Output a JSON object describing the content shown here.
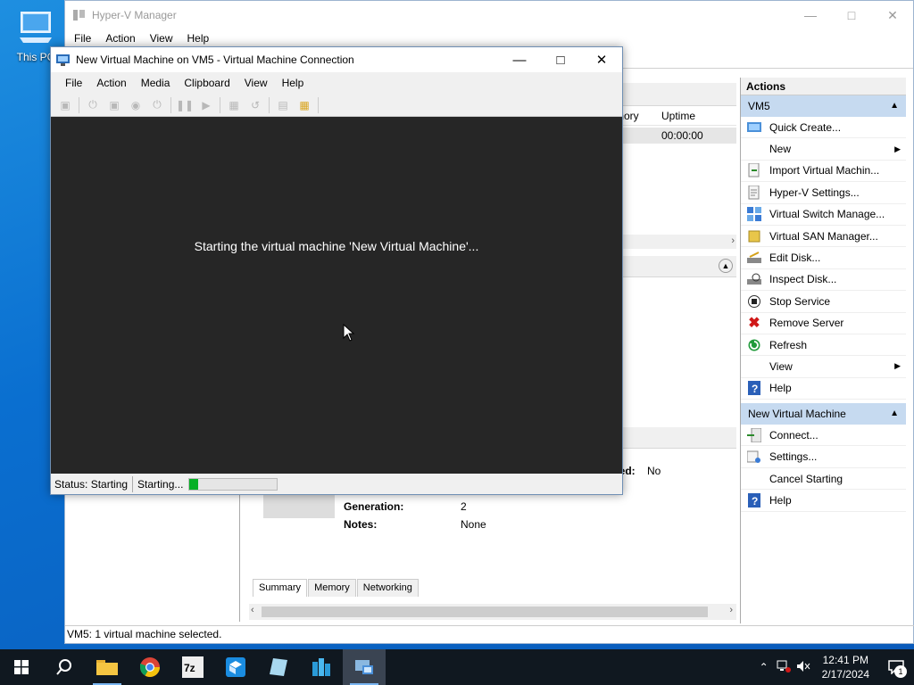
{
  "desktop": {
    "this_pc_label": "This PC"
  },
  "hyperv": {
    "title": "Hyper-V Manager",
    "menu": [
      "File",
      "Action",
      "View",
      "Help"
    ],
    "columns": {
      "memory": "mory",
      "uptime": "Uptime"
    },
    "vm_row": {
      "uptime": "00:00:00"
    },
    "details": {
      "clustered_label": "red:",
      "clustered_value": "No",
      "generation_label": "Generation:",
      "generation_value": "2",
      "notes_label": "Notes:",
      "notes_value": "None"
    },
    "tabs": [
      "Summary",
      "Memory",
      "Networking"
    ],
    "status": "VM5:  1 virtual machine selected."
  },
  "actions": {
    "header": "Actions",
    "group1": "VM5",
    "group1_items": [
      {
        "label": "Quick Create...",
        "icon": "quick-create-icon"
      },
      {
        "label": "New",
        "icon": "none",
        "submenu": true
      },
      {
        "label": "Import Virtual Machin...",
        "icon": "import-icon"
      },
      {
        "label": "Hyper-V Settings...",
        "icon": "settings-icon"
      },
      {
        "label": "Virtual Switch Manage...",
        "icon": "switch-icon"
      },
      {
        "label": "Virtual SAN Manager...",
        "icon": "san-icon"
      },
      {
        "label": "Edit Disk...",
        "icon": "edit-disk-icon"
      },
      {
        "label": "Inspect Disk...",
        "icon": "inspect-disk-icon"
      },
      {
        "label": "Stop Service",
        "icon": "stop-icon"
      },
      {
        "label": "Remove Server",
        "icon": "remove-icon"
      },
      {
        "label": "Refresh",
        "icon": "refresh-icon"
      },
      {
        "label": "View",
        "icon": "none",
        "submenu": true
      },
      {
        "label": "Help",
        "icon": "help-icon"
      }
    ],
    "group2": "New Virtual Machine",
    "group2_items": [
      {
        "label": "Connect...",
        "icon": "connect-icon"
      },
      {
        "label": "Settings...",
        "icon": "vm-settings-icon"
      },
      {
        "label": "Cancel Starting",
        "icon": "none"
      },
      {
        "label": "Help",
        "icon": "help-icon"
      }
    ]
  },
  "vmconnect": {
    "title": "New Virtual Machine on VM5 - Virtual Machine Connection",
    "menu": [
      "File",
      "Action",
      "Media",
      "Clipboard",
      "View",
      "Help"
    ],
    "message": "Starting the virtual machine 'New Virtual Machine'...",
    "status_label": "Status: Starting",
    "progress_label": "Starting...",
    "progress": 0.1
  },
  "taskbar": {
    "time": "12:41 PM",
    "date": "2/17/2024",
    "notification_count": "1"
  }
}
